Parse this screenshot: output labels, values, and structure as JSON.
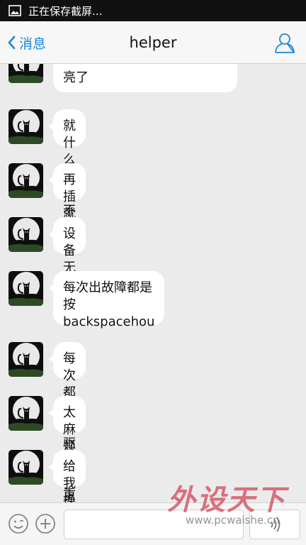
{
  "status_bar": {
    "text": "正在保存截屏..."
  },
  "header": {
    "back_label": "消息",
    "title": "helper"
  },
  "messages": [
    {
      "text": "亮了"
    },
    {
      "text": "就什么也按不动了"
    },
    {
      "text": "再插就这样"
    },
    {
      "text": "设备无法驱动"
    },
    {
      "line1": "每次出故障都是",
      "line2": "按backspacehou"
    },
    {
      "text": "每次都卸载驱动后重装才行"
    },
    {
      "text": "太麻烦了"
    },
    {
      "text": "给我换货吧"
    }
  ],
  "input": {
    "value": "",
    "placeholder": ""
  },
  "watermark": {
    "brand": "外设天下",
    "url": "www.pcwaishe.cn"
  },
  "colors": {
    "accent": "#1a86d9",
    "background": "#ebebeb",
    "bubble": "#ffffff"
  },
  "icons": [
    "image-icon",
    "back-chevron-icon",
    "profile-icon",
    "emoji-icon",
    "plus-icon",
    "voice-icon",
    "cat-avatar"
  ]
}
